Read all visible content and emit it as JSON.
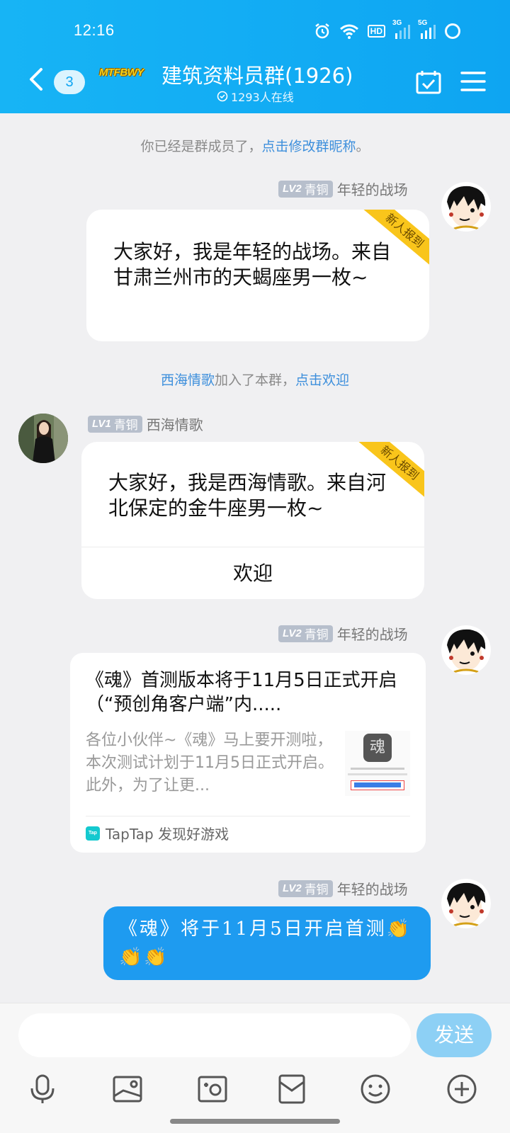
{
  "status_bar": {
    "time": "12:16",
    "hd": "HD",
    "sim1": "3G",
    "sim2": "5G"
  },
  "header": {
    "unread_count": "3",
    "logo_text": "MTFBWY",
    "group_title": "建筑资料员群(1926)",
    "online": "1293人在线"
  },
  "system_messages": {
    "member_prefix": "你已经是群成员了，",
    "member_link": "点击修改群昵称",
    "member_suffix": "。",
    "join_name": "西海情歌",
    "join_text": "加入了本群，",
    "join_link": "点击欢迎"
  },
  "messages": [
    {
      "sender": "年轻的战场",
      "level": "LV2",
      "rank": "青铜",
      "ribbon": "新人报到",
      "text": "大家好，我是年轻的战场。来自甘肃兰州市的天蝎座男一枚~"
    },
    {
      "sender": "西海情歌",
      "level": "LV1",
      "rank": "青铜",
      "ribbon": "新人报到",
      "text": "大家好，我是西海情歌。来自河北保定的金牛座男一枚~",
      "action": "欢迎"
    },
    {
      "sender": "年轻的战场",
      "level": "LV2",
      "rank": "青铜",
      "card_title": "《魂》首测版本将于11月5日正式开启（“预创角客户端”内.....",
      "card_desc": "各位小伙伴~《魂》马上要开测啦，本次测试计划于11月5日正式开启。此外，为了让更...",
      "source_logo": "Tap",
      "source": "TapTap 发现好游戏",
      "thumb_logo": "魂"
    },
    {
      "sender": "年轻的战场",
      "level": "LV2",
      "rank": "青铜",
      "text": "《魂》将于11月5日开启首测👏👏👏"
    }
  ],
  "input": {
    "placeholder": "",
    "send_label": "发送"
  },
  "toolbar": [
    "mic-icon",
    "image-icon",
    "camera-icon",
    "red-packet-icon",
    "emoji-icon",
    "plus-icon"
  ],
  "colors": {
    "header": "#0ea5f2",
    "link": "#3d8fdc",
    "blue_bubble": "#1e9bf0",
    "send_button": "#8dd0f5"
  }
}
